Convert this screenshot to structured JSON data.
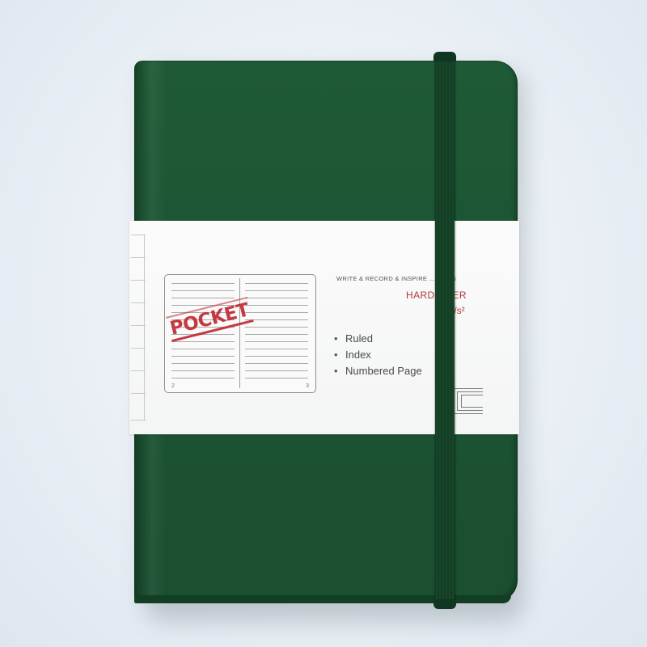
{
  "image": {
    "subject": "notebook",
    "colors": {
      "background": "#e9eff5",
      "cover": "#1c5432",
      "band": "#f7f7f7",
      "accent_red": "#b8323e",
      "elastic": "#16432a"
    }
  },
  "band": {
    "stamp": "POCKET",
    "tagline": "WRITE & RECORD & INSPIRE ... IDEAS",
    "hardcover": "HARD  OVER",
    "gsm": "0g/s²",
    "features": [
      "Ruled",
      "Index",
      "Numbered Page"
    ],
    "page_numbers": [
      "2",
      "3"
    ]
  }
}
